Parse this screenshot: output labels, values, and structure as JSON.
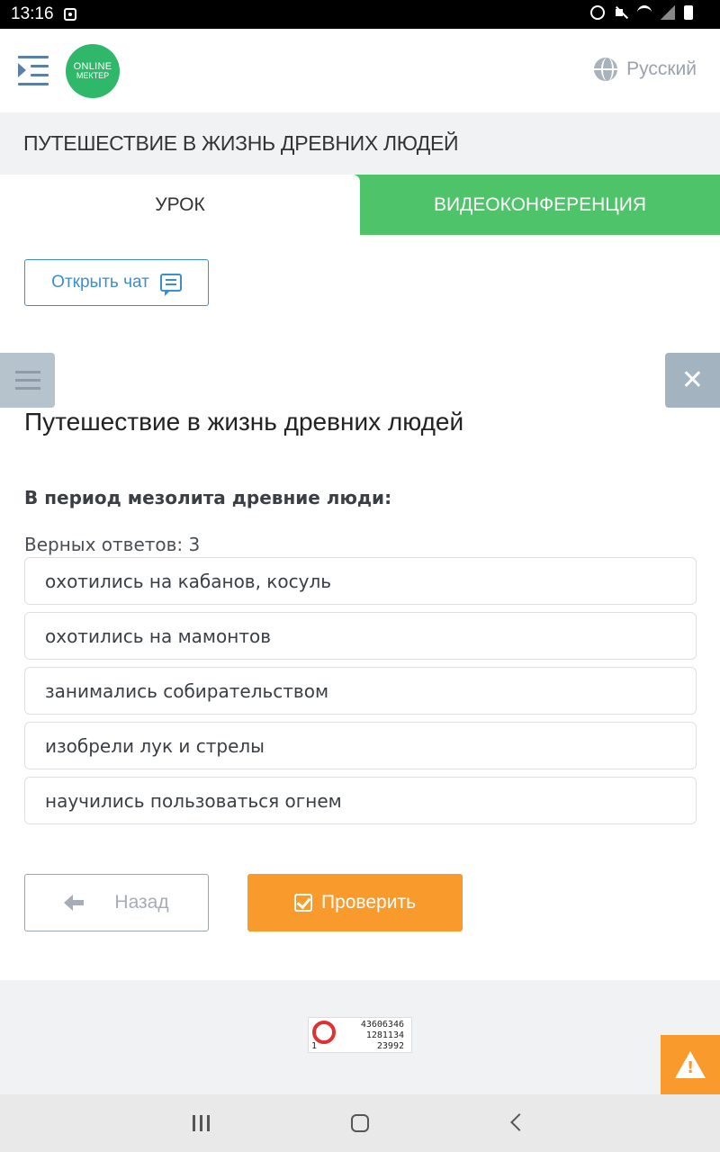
{
  "status_bar": {
    "time": "13:16"
  },
  "header": {
    "logo_line1": "ONLINE",
    "logo_line2": "МЕКТЕР",
    "language": "Русский"
  },
  "lesson": {
    "title": "ПУТЕШЕСТВИЕ В ЖИЗНЬ ДРЕВНИХ ЛЮДЕЙ"
  },
  "tabs": [
    {
      "label": "УРОК",
      "active": true
    },
    {
      "label": "ВИДЕОКОНФЕРЕНЦИЯ",
      "active": false
    }
  ],
  "chat": {
    "label": "Открыть чат"
  },
  "question": {
    "title": "Путешествие в жизнь древних людей",
    "text": "В период мезолита древние люди:",
    "correct_count": "Верных ответов: 3",
    "answers": [
      "охотились на кабанов, косуль",
      "охотились на мамонтов",
      "занимались собирательством",
      "изобрели лук и стрелы",
      "научились пользоваться огнем"
    ]
  },
  "buttons": {
    "back": "Назад",
    "check": "Проверить"
  },
  "counter": {
    "line1": "43606346",
    "line2": "1281134",
    "line3": "23992",
    "left": "1"
  },
  "colors": {
    "brand_green": "#4ec36a",
    "accent_orange": "#f99a2c",
    "link_blue": "#3c8fcf"
  }
}
